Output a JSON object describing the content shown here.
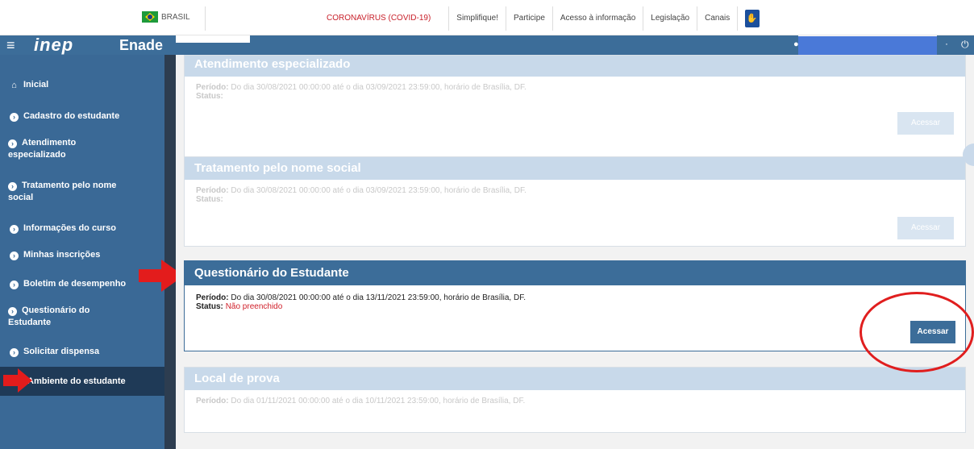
{
  "gov_bar": {
    "brasil": "BRASIL",
    "links": [
      "CORONAVÍRUS (COVID-19)",
      "Simplifique!",
      "Participe",
      "Acesso à informação",
      "Legislação",
      "Canais"
    ]
  },
  "app_header": {
    "logo": "inep",
    "app_name": "Enade"
  },
  "sidebar": {
    "items": [
      {
        "label": "Inicial",
        "icon": "home-icon"
      },
      {
        "label": "Cadastro do estudante",
        "icon": "circle-arrow-icon"
      },
      {
        "label_1": "Atendimento",
        "label_2": "especializado",
        "icon": "circle-arrow-icon"
      },
      {
        "label_1": "Tratamento pelo nome",
        "label_2": "social",
        "icon": "circle-arrow-icon"
      },
      {
        "label": "Informações do curso",
        "icon": "circle-arrow-icon"
      },
      {
        "label": "Minhas inscrições",
        "icon": "circle-arrow-icon"
      },
      {
        "label": "Boletim de desempenho",
        "icon": "circle-arrow-icon"
      },
      {
        "label_1": "Questionário do",
        "label_2": "Estudante",
        "icon": "circle-arrow-icon"
      },
      {
        "label": "Solicitar dispensa",
        "icon": "circle-arrow-icon"
      },
      {
        "label": "Ambiente do estudante",
        "icon": "circle-arrow-icon"
      }
    ]
  },
  "panels": [
    {
      "title": "Atendimento especializado",
      "period_label": "Período:",
      "period_text": "Do dia 30/08/2021 00:00:00 até o dia 03/09/2021 23:59:00, horário de Brasília, DF.",
      "status_label": "Status:",
      "status_value": "",
      "button": "Acessar"
    },
    {
      "title": "Tratamento pelo nome social",
      "period_label": "Período:",
      "period_text": "Do dia 30/08/2021 00:00:00 até o dia 03/09/2021 23:59:00, horário de Brasília, DF.",
      "status_label": "Status:",
      "status_value": "",
      "button": "Acessar"
    },
    {
      "title": "Questionário do Estudante",
      "period_label": "Período:",
      "period_text": "Do dia 30/08/2021 00:00:00 até o dia 13/11/2021 23:59:00, horário de Brasília, DF.",
      "status_label": "Status:",
      "status_value": "Não preenchido",
      "button": "Acessar"
    },
    {
      "title": "Local de prova",
      "period_label": "Período:",
      "period_text": "Do dia 01/11/2021 00:00:00 até o dia 10/11/2021 23:59:00, horário de Brasília, DF."
    }
  ],
  "colors": {
    "header_blue": "#3c6d99",
    "sidebar_blue": "#3a6996",
    "annotation_red": "#e31c1c",
    "status_red": "#d0202a"
  }
}
